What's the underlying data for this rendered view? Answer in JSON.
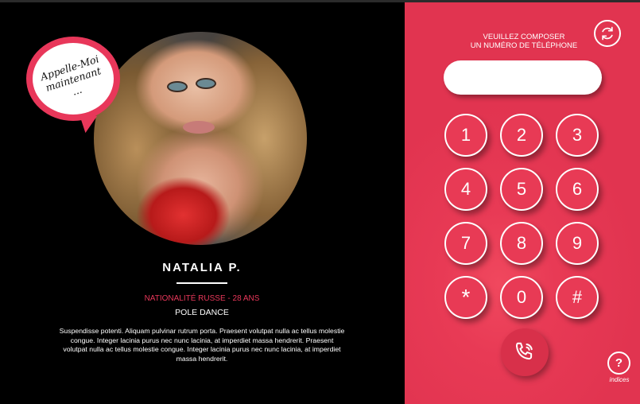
{
  "profile": {
    "bubble_text": "Appelle-Moi\nmaintenant\n...",
    "name": "NATALIA P.",
    "nationality": "NATIONALITÉ RUSSE - 28 ANS",
    "activity": "POLE DANCE",
    "bio": "Suspendisse potenti. Aliquam pulvinar rutrum porta. Praesent volutpat nulla ac tellus molestie congue. Integer lacinia purus nec nunc lacinia, at imperdiet massa hendrerit. Praesent volutpat nulla ac tellus molestie congue. Integer lacinia purus nec nunc lacinia, at imperdiet massa hendrerit."
  },
  "dialer": {
    "prompt": "VEUILLEZ COMPOSER\nUN NUMÉRO DE TÉLÉPHONE",
    "display_value": "",
    "keys": [
      "1",
      "2",
      "3",
      "4",
      "5",
      "6",
      "7",
      "8",
      "9",
      "*",
      "0",
      "#"
    ],
    "help_label": "indices",
    "help_symbol": "?"
  },
  "colors": {
    "accent": "#e8375a",
    "background": "#000000",
    "text": "#ffffff"
  },
  "icons": {
    "refresh": "refresh-icon",
    "call": "phone-call-icon",
    "help": "help-icon"
  }
}
